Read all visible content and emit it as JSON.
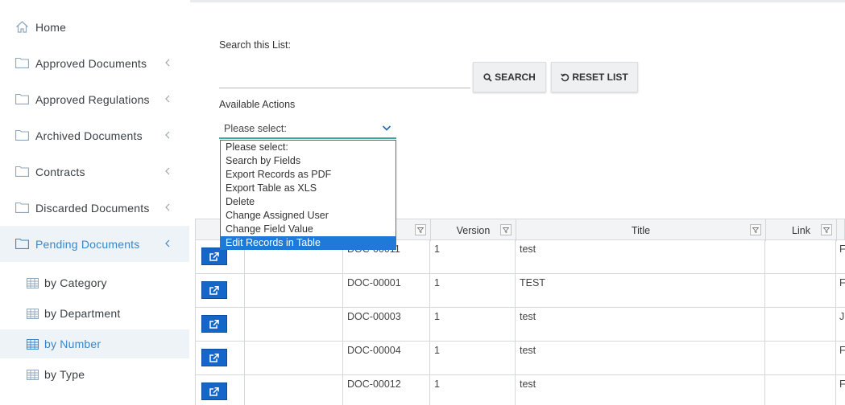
{
  "sidebar": {
    "items": [
      {
        "label": "Home",
        "icon": "home-icon"
      },
      {
        "label": "Approved Documents",
        "icon": "folder-icon"
      },
      {
        "label": "Approved Regulations",
        "icon": "folder-icon"
      },
      {
        "label": "Archived Documents",
        "icon": "folder-icon"
      },
      {
        "label": "Contracts",
        "icon": "folder-icon"
      },
      {
        "label": "Discarded Documents",
        "icon": "folder-icon"
      },
      {
        "label": "Pending Documents",
        "icon": "folder-icon",
        "active": true
      }
    ],
    "subitems": [
      {
        "label": "by Category",
        "icon": "table-icon"
      },
      {
        "label": "by Department",
        "icon": "table-icon"
      },
      {
        "label": "by Number",
        "icon": "table-icon",
        "active": true
      },
      {
        "label": "by Type",
        "icon": "table-icon"
      }
    ]
  },
  "search": {
    "label": "Search this List:",
    "value": "",
    "search_button": "SEARCH",
    "reset_button": "RESET LIST"
  },
  "actions": {
    "label": "Available Actions",
    "selected": "Please select:",
    "options": [
      "Please select:",
      "Search by Fields",
      "Export Records as PDF",
      "Export Table as XLS",
      "Delete",
      "Change Assigned User",
      "Change Field Value",
      "Edit Records in Table"
    ],
    "highlighted": "Edit Records in Table"
  },
  "table": {
    "columns": [
      "",
      "",
      "",
      "Version",
      "Title",
      "Link",
      ""
    ],
    "rows": [
      {
        "number": "DOC-00011",
        "version": "1",
        "title": "test",
        "link": "",
        "extra": "F"
      },
      {
        "number": "DOC-00001",
        "version": "1",
        "title": "TEST",
        "link": "",
        "extra": "F"
      },
      {
        "number": "DOC-00003",
        "version": "1",
        "title": "test",
        "link": "",
        "extra": "J"
      },
      {
        "number": "DOC-00004",
        "version": "1",
        "title": "test",
        "link": "",
        "extra": "F"
      },
      {
        "number": "DOC-00012",
        "version": "1",
        "title": "test",
        "link": "",
        "extra": "F"
      }
    ]
  },
  "colors": {
    "accent": "#3a86c8",
    "active_bg": "#eef3f8",
    "open_button": "#1466c8",
    "dropdown_highlight": "#1e7ad6",
    "select_underline": "#3aa89c"
  }
}
